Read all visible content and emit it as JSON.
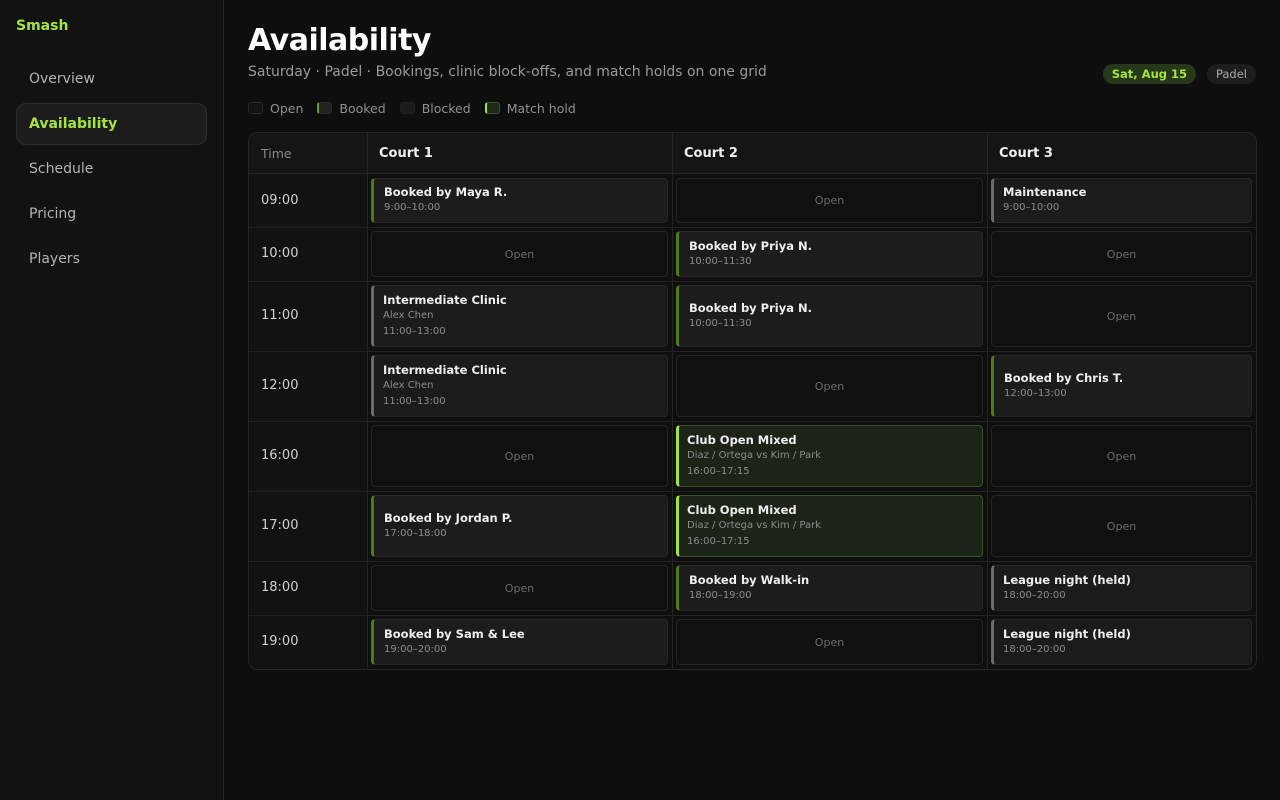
{
  "app": {
    "brand": "Smash"
  },
  "nav": [
    "Overview",
    "Availability",
    "Schedule",
    "Pricing",
    "Players"
  ],
  "header": {
    "title": "Availability",
    "subtitle": "Saturday · Padel · Bookings, clinic block-offs, and match holds on one grid",
    "date": "Sat, Aug 15",
    "sport": "Padel"
  },
  "legend": [
    "Open",
    "Booked",
    "Blocked",
    "Match hold"
  ],
  "grid": {
    "time_header": "Time",
    "courts": [
      "Court 1",
      "Court 2",
      "Court 3"
    ],
    "times": [
      "09:00",
      "10:00",
      "11:00",
      "12:00",
      "16:00",
      "17:00",
      "18:00",
      "19:00"
    ],
    "open_label": "Open",
    "cells": [
      [
        {
          "type": "booked",
          "title": "Booked by Maya R.",
          "time": "9:00–10:00"
        },
        {
          "type": "open"
        },
        {
          "type": "blocked",
          "title": "Maintenance",
          "time": "9:00–10:00"
        }
      ],
      [
        {
          "type": "open"
        },
        {
          "type": "booked",
          "title": "Booked by Priya N.",
          "time": "10:00–11:30"
        },
        {
          "type": "open"
        }
      ],
      [
        {
          "type": "blocked",
          "title": "Intermediate Clinic",
          "sub": "Alex Chen",
          "time": "11:00–13:00"
        },
        {
          "type": "booked",
          "title": "Booked by Priya N.",
          "time": "10:00–11:30"
        },
        {
          "type": "open"
        }
      ],
      [
        {
          "type": "blocked",
          "title": "Intermediate Clinic",
          "sub": "Alex Chen",
          "time": "11:00–13:00"
        },
        {
          "type": "open"
        },
        {
          "type": "booked",
          "title": "Booked by Chris T.",
          "time": "12:00–13:00"
        }
      ],
      [
        {
          "type": "open"
        },
        {
          "type": "hold",
          "title": "Club Open Mixed",
          "sub": "Diaz / Ortega vs Kim / Park",
          "time": "16:00–17:15"
        },
        {
          "type": "open"
        }
      ],
      [
        {
          "type": "booked",
          "title": "Booked by Jordan P.",
          "time": "17:00–18:00"
        },
        {
          "type": "hold",
          "title": "Club Open Mixed",
          "sub": "Diaz / Ortega vs Kim / Park",
          "time": "16:00–17:15"
        },
        {
          "type": "open"
        }
      ],
      [
        {
          "type": "open"
        },
        {
          "type": "booked",
          "title": "Booked by Walk-in",
          "time": "18:00–19:00"
        },
        {
          "type": "blocked",
          "title": "League night (held)",
          "time": "18:00–20:00"
        }
      ],
      [
        {
          "type": "booked",
          "title": "Booked by Sam & Lee",
          "time": "19:00–20:00"
        },
        {
          "type": "open"
        },
        {
          "type": "blocked",
          "title": "League night (held)",
          "time": "18:00–20:00"
        }
      ]
    ]
  },
  "colors": {
    "accent": "#a3e635",
    "booked_border": "#4d7c0f",
    "blocked_border": "#6b6b6b",
    "background": "#0e0e0e"
  }
}
